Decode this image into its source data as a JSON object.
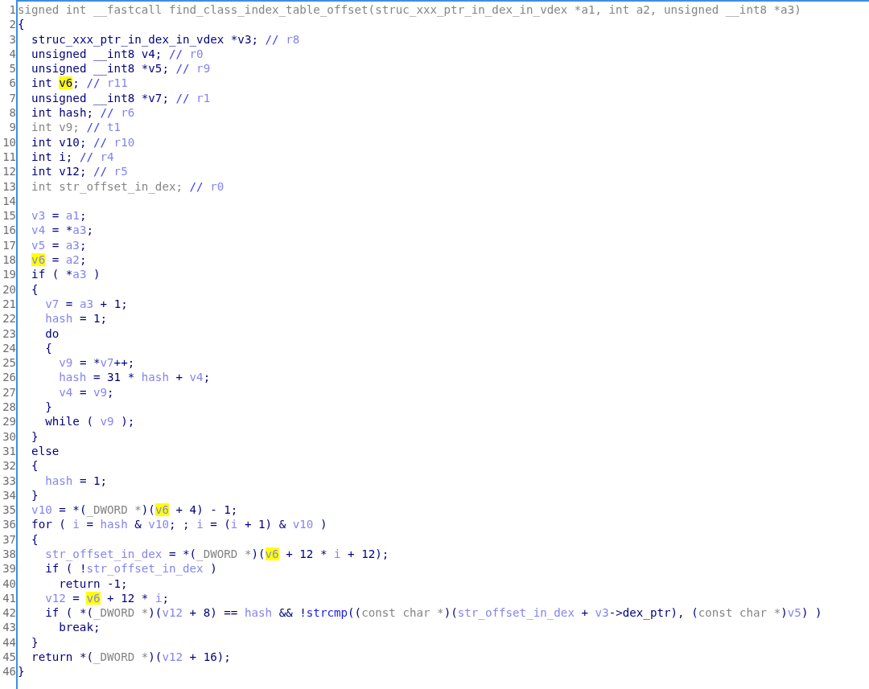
{
  "lines": [
    {
      "number": "1",
      "segments": [
        {
          "kind": "type",
          "text": "signed int __fastcall find_class_index_table_offset(struc_xxx_ptr_in_dex_in_vdex *a1, int a2, unsigned __int8 *a3)"
        }
      ]
    },
    {
      "number": "2",
      "segments": [
        {
          "kind": "code",
          "text": "{"
        }
      ]
    },
    {
      "number": "3",
      "segments": [
        {
          "kind": "code",
          "text": "  struc_xxx_ptr_in_dex_in_vdex *v3; "
        },
        {
          "kind": "comment",
          "text": "// "
        },
        {
          "kind": "var",
          "text": "r8"
        }
      ]
    },
    {
      "number": "4",
      "segments": [
        {
          "kind": "code",
          "text": "  unsigned __int8 v4; "
        },
        {
          "kind": "comment",
          "text": "// "
        },
        {
          "kind": "var",
          "text": "r0"
        }
      ]
    },
    {
      "number": "5",
      "segments": [
        {
          "kind": "code",
          "text": "  unsigned __int8 *v5; "
        },
        {
          "kind": "comment",
          "text": "// "
        },
        {
          "kind": "var",
          "text": "r9"
        }
      ]
    },
    {
      "number": "6",
      "segments": [
        {
          "kind": "code",
          "text": "  int "
        },
        {
          "kind": "highlight",
          "text": "v6"
        },
        {
          "kind": "code",
          "text": "; "
        },
        {
          "kind": "comment",
          "text": "// "
        },
        {
          "kind": "var",
          "text": "r11"
        }
      ]
    },
    {
      "number": "7",
      "segments": [
        {
          "kind": "code",
          "text": "  unsigned __int8 *v7; "
        },
        {
          "kind": "comment",
          "text": "// "
        },
        {
          "kind": "var",
          "text": "r1"
        }
      ]
    },
    {
      "number": "8",
      "segments": [
        {
          "kind": "code",
          "text": "  int hash; "
        },
        {
          "kind": "comment",
          "text": "// "
        },
        {
          "kind": "var",
          "text": "r6"
        }
      ]
    },
    {
      "number": "9",
      "segments": [
        {
          "kind": "type",
          "text": "  int v9; "
        },
        {
          "kind": "comment",
          "text": "// "
        },
        {
          "kind": "var",
          "text": "t1"
        }
      ]
    },
    {
      "number": "10",
      "segments": [
        {
          "kind": "code",
          "text": "  int v10; "
        },
        {
          "kind": "comment",
          "text": "// "
        },
        {
          "kind": "var",
          "text": "r10"
        }
      ]
    },
    {
      "number": "11",
      "segments": [
        {
          "kind": "code",
          "text": "  int i; "
        },
        {
          "kind": "comment",
          "text": "// "
        },
        {
          "kind": "var",
          "text": "r4"
        }
      ]
    },
    {
      "number": "12",
      "segments": [
        {
          "kind": "code",
          "text": "  int v12; "
        },
        {
          "kind": "comment",
          "text": "// "
        },
        {
          "kind": "var",
          "text": "r5"
        }
      ]
    },
    {
      "number": "13",
      "segments": [
        {
          "kind": "type",
          "text": "  int str_offset_in_dex; "
        },
        {
          "kind": "comment",
          "text": "// "
        },
        {
          "kind": "var",
          "text": "r0"
        }
      ]
    },
    {
      "number": "14"
    },
    {
      "number": "15",
      "segments": [
        {
          "kind": "var",
          "text": "  v3"
        },
        {
          "kind": "code",
          "text": " = "
        },
        {
          "kind": "var",
          "text": "a1"
        },
        {
          "kind": "code",
          "text": ";"
        }
      ]
    },
    {
      "number": "16",
      "segments": [
        {
          "kind": "var",
          "text": "  v4"
        },
        {
          "kind": "code",
          "text": " = *"
        },
        {
          "kind": "var",
          "text": "a3"
        },
        {
          "kind": "code",
          "text": ";"
        }
      ]
    },
    {
      "number": "17",
      "segments": [
        {
          "kind": "var",
          "text": "  v5"
        },
        {
          "kind": "code",
          "text": " = "
        },
        {
          "kind": "var",
          "text": "a3"
        },
        {
          "kind": "code",
          "text": ";"
        }
      ]
    },
    {
      "number": "18",
      "segments": [
        {
          "kind": "highlight_var",
          "text": "  v6"
        },
        {
          "kind": "code",
          "text": " = "
        },
        {
          "kind": "var",
          "text": "a2"
        },
        {
          "kind": "code",
          "text": ";"
        }
      ]
    },
    {
      "number": "19",
      "segments": [
        {
          "kind": "code",
          "text": "  if ( *"
        },
        {
          "kind": "var",
          "text": "a3"
        },
        {
          "kind": "code",
          "text": " )"
        }
      ]
    },
    {
      "number": "20",
      "segments": [
        {
          "kind": "code",
          "text": "  {"
        }
      ]
    },
    {
      "number": "21",
      "segments": [
        {
          "kind": "var",
          "text": "    v7"
        },
        {
          "kind": "code",
          "text": " = "
        },
        {
          "kind": "var",
          "text": "a3"
        },
        {
          "kind": "code",
          "text": " + 1;"
        }
      ]
    },
    {
      "number": "22",
      "segments": [
        {
          "kind": "var",
          "text": "    hash"
        },
        {
          "kind": "code",
          "text": " = 1;"
        }
      ]
    },
    {
      "number": "23",
      "segments": [
        {
          "kind": "code",
          "text": "    do"
        }
      ]
    },
    {
      "number": "24",
      "segments": [
        {
          "kind": "code",
          "text": "    {"
        }
      ]
    },
    {
      "number": "25",
      "segments": [
        {
          "kind": "var",
          "text": "      v9"
        },
        {
          "kind": "code",
          "text": " = *"
        },
        {
          "kind": "var",
          "text": "v7"
        },
        {
          "kind": "code",
          "text": "++;"
        }
      ]
    },
    {
      "number": "26",
      "segments": [
        {
          "kind": "var",
          "text": "      hash"
        },
        {
          "kind": "code",
          "text": " = 31 * "
        },
        {
          "kind": "var",
          "text": "hash"
        },
        {
          "kind": "code",
          "text": " + "
        },
        {
          "kind": "var",
          "text": "v4"
        },
        {
          "kind": "code",
          "text": ";"
        }
      ]
    },
    {
      "number": "27",
      "segments": [
        {
          "kind": "var",
          "text": "      v4"
        },
        {
          "kind": "code",
          "text": " = "
        },
        {
          "kind": "var",
          "text": "v9"
        },
        {
          "kind": "code",
          "text": ";"
        }
      ]
    },
    {
      "number": "28",
      "segments": [
        {
          "kind": "code",
          "text": "    }"
        }
      ]
    },
    {
      "number": "29",
      "segments": [
        {
          "kind": "code",
          "text": "    while ( "
        },
        {
          "kind": "var",
          "text": "v9"
        },
        {
          "kind": "code",
          "text": " );"
        }
      ]
    },
    {
      "number": "30",
      "segments": [
        {
          "kind": "code",
          "text": "  }"
        }
      ]
    },
    {
      "number": "31",
      "segments": [
        {
          "kind": "code",
          "text": "  else"
        }
      ]
    },
    {
      "number": "32",
      "segments": [
        {
          "kind": "code",
          "text": "  {"
        }
      ]
    },
    {
      "number": "33",
      "segments": [
        {
          "kind": "var",
          "text": "    hash"
        },
        {
          "kind": "code",
          "text": " = 1;"
        }
      ]
    },
    {
      "number": "34",
      "segments": [
        {
          "kind": "code",
          "text": "  }"
        }
      ]
    },
    {
      "number": "35",
      "segments": [
        {
          "kind": "var",
          "text": "  v10"
        },
        {
          "kind": "code",
          "text": " = *("
        },
        {
          "kind": "type",
          "text": "_DWORD *"
        },
        {
          "kind": "code",
          "text": ")("
        },
        {
          "kind": "highlight_var",
          "text": "v6"
        },
        {
          "kind": "code",
          "text": " + 4) - 1;"
        }
      ]
    },
    {
      "number": "36",
      "segments": [
        {
          "kind": "code",
          "text": "  for ( "
        },
        {
          "kind": "var",
          "text": "i"
        },
        {
          "kind": "code",
          "text": " = "
        },
        {
          "kind": "var",
          "text": "hash"
        },
        {
          "kind": "code",
          "text": " & "
        },
        {
          "kind": "var",
          "text": "v10"
        },
        {
          "kind": "code",
          "text": "; ; "
        },
        {
          "kind": "var",
          "text": "i"
        },
        {
          "kind": "code",
          "text": " = ("
        },
        {
          "kind": "var",
          "text": "i"
        },
        {
          "kind": "code",
          "text": " + 1) & "
        },
        {
          "kind": "var",
          "text": "v10"
        },
        {
          "kind": "code",
          "text": " )"
        }
      ]
    },
    {
      "number": "37",
      "segments": [
        {
          "kind": "code",
          "text": "  {"
        }
      ]
    },
    {
      "number": "38",
      "segments": [
        {
          "kind": "var",
          "text": "    str_offset_in_dex"
        },
        {
          "kind": "code",
          "text": " = *("
        },
        {
          "kind": "type",
          "text": "_DWORD *"
        },
        {
          "kind": "code",
          "text": ")("
        },
        {
          "kind": "highlight_var",
          "text": "v6"
        },
        {
          "kind": "code",
          "text": " + 12 * "
        },
        {
          "kind": "var",
          "text": "i"
        },
        {
          "kind": "code",
          "text": " + 12);"
        }
      ]
    },
    {
      "number": "39",
      "segments": [
        {
          "kind": "code",
          "text": "    if ( !"
        },
        {
          "kind": "var",
          "text": "str_offset_in_dex"
        },
        {
          "kind": "code",
          "text": " )"
        }
      ]
    },
    {
      "number": "40",
      "segments": [
        {
          "kind": "code",
          "text": "      return -1;"
        }
      ]
    },
    {
      "number": "41",
      "segments": [
        {
          "kind": "var",
          "text": "    v12"
        },
        {
          "kind": "code",
          "text": " = "
        },
        {
          "kind": "highlight_var",
          "text": "v6"
        },
        {
          "kind": "code",
          "text": " + 12 * "
        },
        {
          "kind": "var",
          "text": "i"
        },
        {
          "kind": "code",
          "text": ";"
        }
      ]
    },
    {
      "number": "42",
      "segments": [
        {
          "kind": "code",
          "text": "    if ( *("
        },
        {
          "kind": "type",
          "text": "_DWORD *"
        },
        {
          "kind": "code",
          "text": ")("
        },
        {
          "kind": "var",
          "text": "v12"
        },
        {
          "kind": "code",
          "text": " + 8) == "
        },
        {
          "kind": "var",
          "text": "hash"
        },
        {
          "kind": "code",
          "text": " && !"
        },
        {
          "kind": "func",
          "text": "strcmp"
        },
        {
          "kind": "code",
          "text": "(("
        },
        {
          "kind": "type",
          "text": "const char *"
        },
        {
          "kind": "code",
          "text": ")("
        },
        {
          "kind": "var",
          "text": "str_offset_in_dex"
        },
        {
          "kind": "code",
          "text": " + "
        },
        {
          "kind": "var",
          "text": "v3"
        },
        {
          "kind": "code",
          "text": "->dex_ptr), ("
        },
        {
          "kind": "type",
          "text": "const char *"
        },
        {
          "kind": "code",
          "text": ")"
        },
        {
          "kind": "var",
          "text": "v5"
        },
        {
          "kind": "code",
          "text": ") )"
        }
      ]
    },
    {
      "number": "43",
      "segments": [
        {
          "kind": "code",
          "text": "      break;"
        }
      ]
    },
    {
      "number": "44",
      "segments": [
        {
          "kind": "code",
          "text": "  }"
        }
      ]
    },
    {
      "number": "45",
      "segments": [
        {
          "kind": "code",
          "text": "  return *("
        },
        {
          "kind": "type",
          "text": "_DWORD *"
        },
        {
          "kind": "code",
          "text": ")("
        },
        {
          "kind": "var",
          "text": "v12"
        },
        {
          "kind": "code",
          "text": " + 16);"
        }
      ]
    },
    {
      "number": "46",
      "segments": [
        {
          "kind": "code",
          "text": "}"
        }
      ]
    }
  ]
}
